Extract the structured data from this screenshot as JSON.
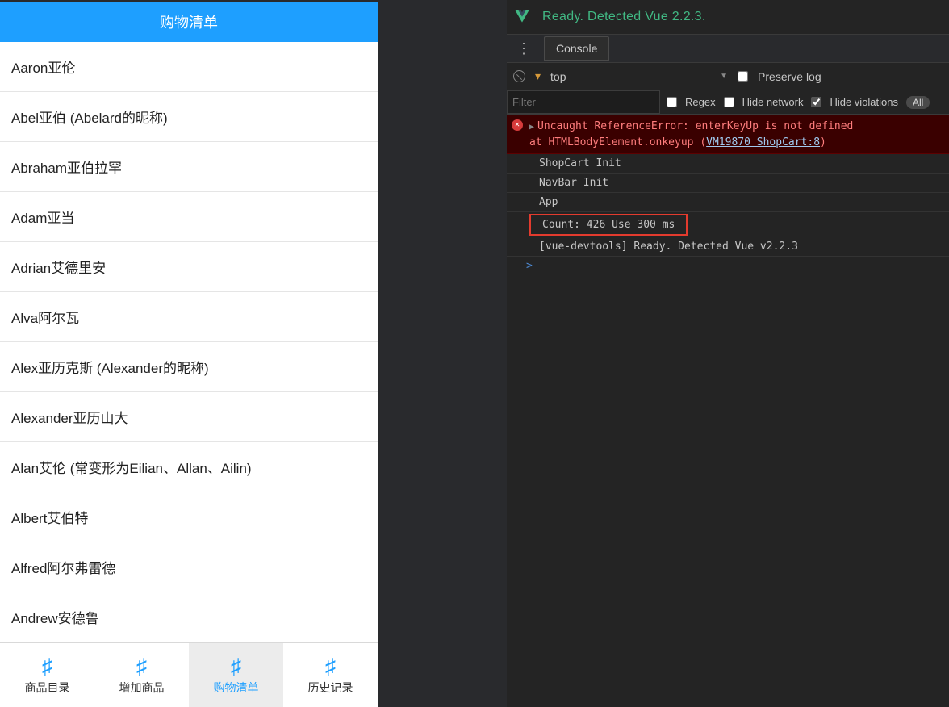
{
  "app": {
    "title": "购物清单",
    "items": [
      "Aaron亚伦",
      "Abel亚伯 (Abelard的昵称)",
      "Abraham亚伯拉罕",
      "Adam亚当",
      "Adrian艾德里安",
      "Alva阿尔瓦",
      "Alex亚历克斯 (Alexander的昵称)",
      "Alexander亚历山大",
      "Alan艾伦 (常变形为Eilian、Allan、Ailin)",
      "Albert艾伯特",
      "Alfred阿尔弗雷德",
      "Andrew安德鲁"
    ],
    "nav": [
      {
        "label": "商品目录",
        "active": false
      },
      {
        "label": "增加商品",
        "active": false
      },
      {
        "label": "购物清单",
        "active": true
      },
      {
        "label": "历史记录",
        "active": false
      }
    ]
  },
  "devtools": {
    "vue_banner": "Ready. Detected Vue 2.2.3.",
    "tab_console": "Console",
    "context": "top",
    "preserve_log_label": "Preserve log",
    "filter_placeholder": "Filter",
    "regex_label": "Regex",
    "hide_network_label": "Hide network",
    "hide_violations_label": "Hide violations",
    "all_pill": "All",
    "error": {
      "line1": "Uncaught ReferenceError: enterKeyUp is not defined",
      "line2_prefix": "    at HTMLBodyElement.onkeyup (",
      "line2_link": "VM19870 ShopCart:8",
      "line2_suffix": ")"
    },
    "logs": [
      "ShopCart Init",
      "NavBar Init",
      "App",
      "Count: 426 Use 300 ms",
      "[vue-devtools] Ready. Detected Vue v2.2.3"
    ],
    "prompt": ">"
  }
}
